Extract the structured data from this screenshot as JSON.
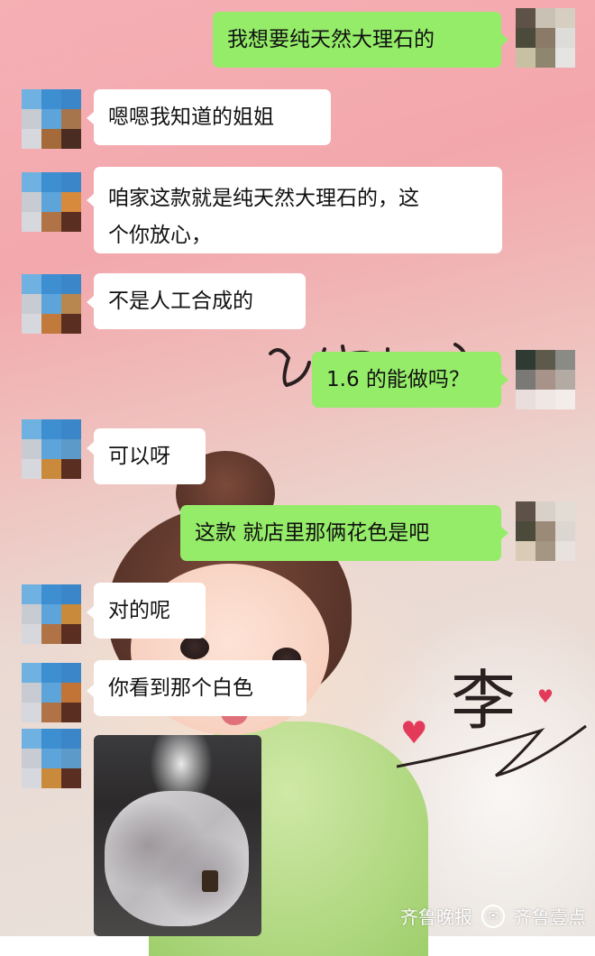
{
  "messages": [
    {
      "text": "我想要纯天然大理石的"
    },
    {
      "text": "嗯嗯我知道的姐姐"
    },
    {
      "line1": "咱家这款就是纯天然大理石的，这",
      "line2": "个你放心，"
    },
    {
      "text": "不是人工合成的"
    },
    {
      "text": "1.6 的能做吗？"
    },
    {
      "text": "可以呀"
    },
    {
      "text": "这款 就店里那俩花色是吧"
    },
    {
      "text": "对的呢"
    },
    {
      "text": "你看到那个白色"
    }
  ],
  "photo_message": {
    "icon": "marble-table-photo"
  },
  "wallpaper": {
    "handwriting": "李"
  },
  "watermark": {
    "left": "齐鲁晚报",
    "right": "齐鲁壹点"
  },
  "colors": {
    "outgoing": "#95ec69",
    "incoming": "#ffffff"
  }
}
